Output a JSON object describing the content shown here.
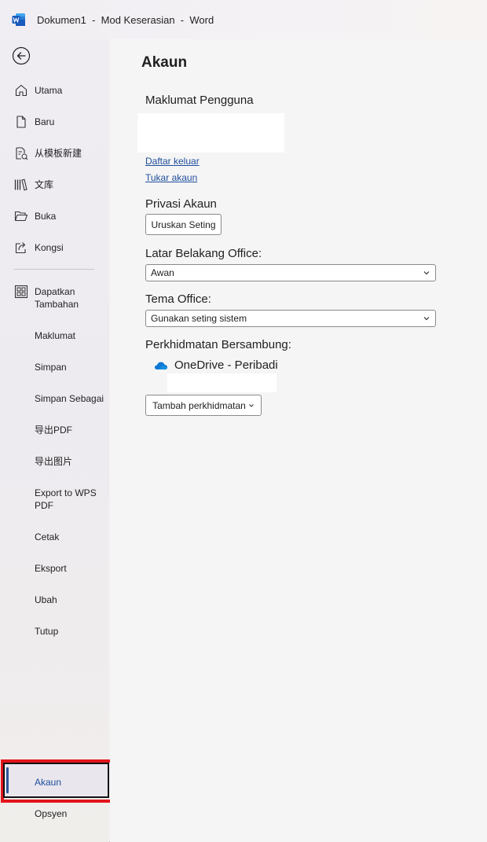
{
  "window": {
    "title": "Dokumen1  -  Mod Keserasian  -  Word"
  },
  "sidebar": {
    "items": [
      {
        "label": "Utama",
        "icon": "home-icon"
      },
      {
        "label": "Baru",
        "icon": "new-document-icon"
      },
      {
        "label": "从模板新建",
        "icon": "template-icon"
      },
      {
        "label": "文库",
        "icon": "library-icon"
      },
      {
        "label": "Buka",
        "icon": "folder-open-icon"
      },
      {
        "label": "Kongsi",
        "icon": "share-icon"
      },
      {
        "label": "Dapatkan Tambahan",
        "icon": "add-ins-icon"
      },
      {
        "label": "Maklumat"
      },
      {
        "label": "Simpan"
      },
      {
        "label": "Simpan Sebagai"
      },
      {
        "label": "导出PDF"
      },
      {
        "label": "导出图片"
      },
      {
        "label": "Export to WPS PDF"
      },
      {
        "label": "Cetak"
      },
      {
        "label": "Eksport"
      },
      {
        "label": "Ubah"
      },
      {
        "label": "Tutup"
      },
      {
        "label": "Akaun",
        "selected": true
      },
      {
        "label": "Opsyen"
      }
    ]
  },
  "main": {
    "title": "Akaun",
    "user_info": {
      "heading": "Maklumat Pengguna",
      "sign_out": "Daftar keluar",
      "switch_account": "Tukar akaun"
    },
    "privacy": {
      "heading": "Privasi Akaun",
      "manage_button": "Uruskan Seting"
    },
    "background": {
      "heading": "Latar Belakang Office:",
      "value": "Awan"
    },
    "theme": {
      "heading": "Tema Office:",
      "value": "Gunakan seting sistem"
    },
    "services": {
      "heading": "Perkhidmatan Bersambung:",
      "onedrive": "OneDrive - Peribadi",
      "add_button": "Tambah perkhidmatan"
    }
  },
  "colors": {
    "accent": "#2b579a",
    "link": "#1e4e9c",
    "highlight_border": "#e3141b",
    "onedrive": "#0f78d4"
  }
}
